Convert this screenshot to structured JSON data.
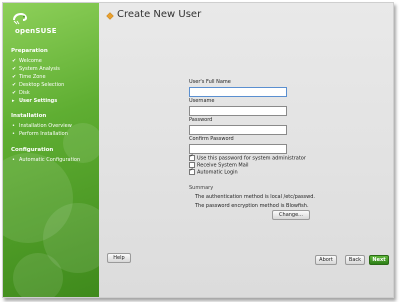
{
  "brand": {
    "name": "openSUSE"
  },
  "sidebar": {
    "sections": [
      {
        "title": "Preparation",
        "items": [
          {
            "label": "Welcome",
            "state": "done"
          },
          {
            "label": "System Analysis",
            "state": "done"
          },
          {
            "label": "Time Zone",
            "state": "done"
          },
          {
            "label": "Desktop Selection",
            "state": "done"
          },
          {
            "label": "Disk",
            "state": "done"
          },
          {
            "label": "User Settings",
            "state": "current"
          }
        ]
      },
      {
        "title": "Installation",
        "items": [
          {
            "label": "Installation Overview",
            "state": "pending"
          },
          {
            "label": "Perform Installation",
            "state": "pending"
          }
        ]
      },
      {
        "title": "Configuration",
        "items": [
          {
            "label": "Automatic Configuration",
            "state": "pending"
          }
        ]
      }
    ],
    "marks": {
      "done": "✔",
      "current": "▸",
      "pending": "•"
    }
  },
  "main": {
    "title": "Create New User",
    "fields": {
      "full_name": {
        "label": "User's Full Name",
        "value": ""
      },
      "username": {
        "label": "Username",
        "value": ""
      },
      "password": {
        "label": "Password",
        "value": ""
      },
      "confirm": {
        "label": "Confirm Password",
        "value": ""
      }
    },
    "options": {
      "admin_password": {
        "label": "Use this password for system administrator",
        "checked": true
      },
      "receive_mail": {
        "label": "Receive System Mail",
        "checked": false
      },
      "auto_login": {
        "label": "Automatic Login",
        "checked": true
      }
    },
    "summary": {
      "title": "Summary",
      "auth_text": "The authentication method is local /etc/passwd.",
      "encryption_text": "The password encryption method is Blowfish.",
      "change_label": "Change..."
    }
  },
  "footer": {
    "help_label": "Help",
    "abort_label": "Abort",
    "back_label": "Back",
    "next_label": "Next"
  },
  "colors": {
    "sidebar_green": "#5fae32",
    "next_green": "#3a8f20",
    "accent_orange": "#e8a030"
  }
}
